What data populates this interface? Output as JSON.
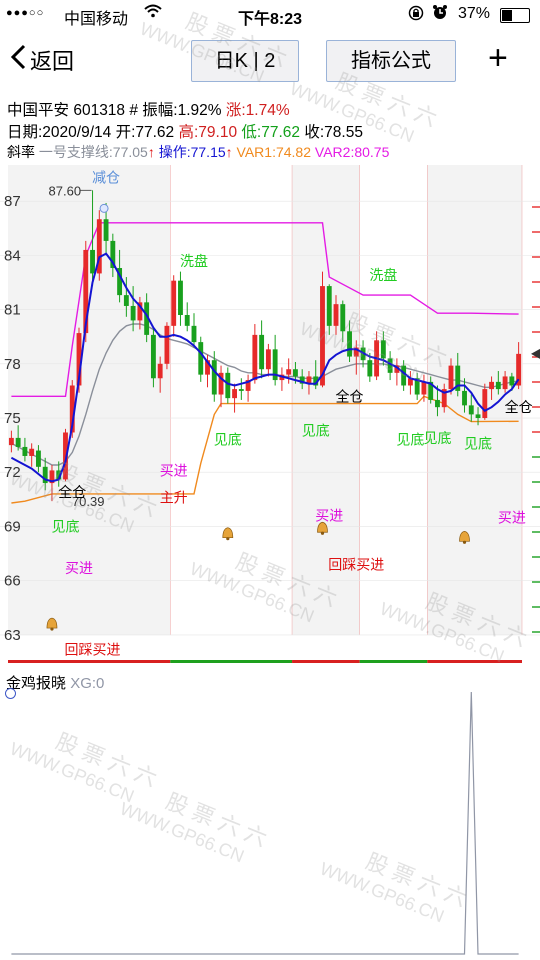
{
  "status_bar": {
    "signal": "●●●○○",
    "carrier": "中国移动",
    "time": "下午8:23",
    "battery_percent": "37%",
    "battery_level": 0.37
  },
  "nav": {
    "back_label": "返回",
    "period_button": "日K | 2",
    "indicator_button": "指标公式",
    "add_label": "+"
  },
  "stock_info": {
    "name": "中国平安",
    "code": "601318",
    "amplitude": "# 振幅:1.92%",
    "change": "涨:1.74%",
    "date": "日期:2020/9/14",
    "open": "开:77.62",
    "high": "高:79.10",
    "low": "低:77.62",
    "close": "收:78.55",
    "legend_prefix": "斜率",
    "legend_support": "一号支撑线:77.05",
    "legend_operate": "操作:77.15",
    "legend_var1": "VAR1:74.82",
    "legend_var2": "VAR2:80.75"
  },
  "colors": {
    "up": "#e62a2a",
    "down": "#19a01e",
    "operate": "#1414d2",
    "support": "#8a8f9a",
    "var1": "#f08a1e",
    "var2": "#e41be4",
    "signal_green": "#22cc22",
    "signal_magenta": "#dd10dd",
    "signal_red": "#dd1010"
  },
  "chart_data": [
    {
      "type": "candlestick",
      "yticks": [
        63,
        66,
        69,
        72,
        75,
        78,
        81,
        84,
        87
      ],
      "ylim": [
        61.5,
        89
      ],
      "max_label": "87.60",
      "min_label": "70.39",
      "candles": [
        {
          "o": 73.5,
          "h": 74.3,
          "l": 73.1,
          "c": 73.9
        },
        {
          "o": 73.9,
          "h": 74.6,
          "l": 73.2,
          "c": 73.4
        },
        {
          "o": 73.4,
          "h": 73.9,
          "l": 72.6,
          "c": 72.9
        },
        {
          "o": 72.9,
          "h": 73.6,
          "l": 72.3,
          "c": 73.3
        },
        {
          "o": 73.2,
          "h": 73.5,
          "l": 72.0,
          "c": 72.3
        },
        {
          "o": 72.3,
          "h": 72.8,
          "l": 71.0,
          "c": 71.4
        },
        {
          "o": 71.4,
          "h": 72.4,
          "l": 70.4,
          "c": 72.1
        },
        {
          "o": 72.1,
          "h": 72.6,
          "l": 71.2,
          "c": 71.6
        },
        {
          "o": 71.6,
          "h": 74.4,
          "l": 71.5,
          "c": 74.2
        },
        {
          "o": 74.2,
          "h": 77.1,
          "l": 73.9,
          "c": 76.8
        },
        {
          "o": 76.8,
          "h": 80.0,
          "l": 76.4,
          "c": 79.7
        },
        {
          "o": 79.7,
          "h": 84.8,
          "l": 79.2,
          "c": 84.3
        },
        {
          "o": 84.3,
          "h": 87.6,
          "l": 82.3,
          "c": 83.0
        },
        {
          "o": 83.0,
          "h": 86.5,
          "l": 82.6,
          "c": 86.0
        },
        {
          "o": 86.0,
          "h": 86.9,
          "l": 84.0,
          "c": 84.8
        },
        {
          "o": 84.8,
          "h": 85.2,
          "l": 82.8,
          "c": 83.3
        },
        {
          "o": 83.3,
          "h": 84.3,
          "l": 81.4,
          "c": 81.8
        },
        {
          "o": 81.8,
          "h": 82.8,
          "l": 80.6,
          "c": 81.2
        },
        {
          "o": 81.2,
          "h": 82.3,
          "l": 79.8,
          "c": 80.4
        },
        {
          "o": 80.4,
          "h": 81.7,
          "l": 79.9,
          "c": 81.4
        },
        {
          "o": 81.4,
          "h": 81.9,
          "l": 79.2,
          "c": 79.6
        },
        {
          "o": 79.6,
          "h": 80.0,
          "l": 76.7,
          "c": 77.2
        },
        {
          "o": 77.2,
          "h": 78.4,
          "l": 76.4,
          "c": 78.0
        },
        {
          "o": 78.0,
          "h": 80.3,
          "l": 77.7,
          "c": 80.1
        },
        {
          "o": 80.1,
          "h": 82.9,
          "l": 79.5,
          "c": 82.6
        },
        {
          "o": 82.6,
          "h": 83.1,
          "l": 80.1,
          "c": 80.7
        },
        {
          "o": 80.7,
          "h": 81.4,
          "l": 79.8,
          "c": 80.1
        },
        {
          "o": 80.1,
          "h": 80.8,
          "l": 78.9,
          "c": 79.2
        },
        {
          "o": 79.2,
          "h": 79.5,
          "l": 77.0,
          "c": 77.4
        },
        {
          "o": 77.4,
          "h": 78.5,
          "l": 76.7,
          "c": 78.2
        },
        {
          "o": 78.2,
          "h": 78.7,
          "l": 75.9,
          "c": 76.3
        },
        {
          "o": 76.3,
          "h": 77.9,
          "l": 75.6,
          "c": 77.5
        },
        {
          "o": 77.5,
          "h": 77.8,
          "l": 75.8,
          "c": 76.1
        },
        {
          "o": 76.1,
          "h": 76.9,
          "l": 75.3,
          "c": 76.6
        },
        {
          "o": 76.6,
          "h": 77.2,
          "l": 76.0,
          "c": 76.5
        },
        {
          "o": 76.5,
          "h": 77.4,
          "l": 75.9,
          "c": 77.1
        },
        {
          "o": 77.1,
          "h": 80.2,
          "l": 76.9,
          "c": 79.6
        },
        {
          "o": 79.6,
          "h": 80.4,
          "l": 77.2,
          "c": 77.7
        },
        {
          "o": 77.7,
          "h": 79.1,
          "l": 77.3,
          "c": 78.8
        },
        {
          "o": 78.8,
          "h": 79.6,
          "l": 76.8,
          "c": 77.1
        },
        {
          "o": 77.1,
          "h": 77.8,
          "l": 76.5,
          "c": 77.4
        },
        {
          "o": 77.4,
          "h": 78.3,
          "l": 76.9,
          "c": 77.7
        },
        {
          "o": 77.7,
          "h": 78.1,
          "l": 76.9,
          "c": 77.3
        },
        {
          "o": 77.3,
          "h": 77.7,
          "l": 76.6,
          "c": 76.9
        },
        {
          "o": 76.9,
          "h": 77.6,
          "l": 76.3,
          "c": 77.3
        },
        {
          "o": 77.3,
          "h": 78.2,
          "l": 76.6,
          "c": 76.8
        },
        {
          "o": 76.8,
          "h": 83.1,
          "l": 76.7,
          "c": 82.3
        },
        {
          "o": 82.3,
          "h": 82.4,
          "l": 79.6,
          "c": 80.1
        },
        {
          "o": 80.1,
          "h": 81.8,
          "l": 79.6,
          "c": 81.3
        },
        {
          "o": 81.3,
          "h": 81.5,
          "l": 79.2,
          "c": 79.8
        },
        {
          "o": 79.8,
          "h": 80.4,
          "l": 78.1,
          "c": 78.4
        },
        {
          "o": 78.4,
          "h": 79.3,
          "l": 77.4,
          "c": 78.9
        },
        {
          "o": 78.9,
          "h": 79.3,
          "l": 77.8,
          "c": 78.2
        },
        {
          "o": 78.2,
          "h": 78.6,
          "l": 77.0,
          "c": 77.3
        },
        {
          "o": 77.3,
          "h": 79.8,
          "l": 77.1,
          "c": 79.3
        },
        {
          "o": 79.3,
          "h": 79.8,
          "l": 77.9,
          "c": 78.3
        },
        {
          "o": 78.3,
          "h": 78.7,
          "l": 77.1,
          "c": 77.5
        },
        {
          "o": 77.5,
          "h": 78.3,
          "l": 76.8,
          "c": 77.9
        },
        {
          "o": 77.9,
          "h": 78.2,
          "l": 76.5,
          "c": 76.8
        },
        {
          "o": 76.8,
          "h": 77.6,
          "l": 76.3,
          "c": 77.2
        },
        {
          "o": 77.2,
          "h": 77.5,
          "l": 76.0,
          "c": 76.3
        },
        {
          "o": 76.3,
          "h": 77.4,
          "l": 75.9,
          "c": 77.0
        },
        {
          "o": 77.0,
          "h": 77.3,
          "l": 75.8,
          "c": 76.0
        },
        {
          "o": 76.0,
          "h": 76.8,
          "l": 75.1,
          "c": 75.6
        },
        {
          "o": 75.6,
          "h": 76.9,
          "l": 75.3,
          "c": 76.6
        },
        {
          "o": 76.6,
          "h": 78.3,
          "l": 76.3,
          "c": 77.9
        },
        {
          "o": 77.9,
          "h": 78.6,
          "l": 76.2,
          "c": 76.5
        },
        {
          "o": 76.5,
          "h": 77.2,
          "l": 75.3,
          "c": 75.7
        },
        {
          "o": 75.7,
          "h": 76.3,
          "l": 74.8,
          "c": 75.2
        },
        {
          "o": 75.2,
          "h": 75.6,
          "l": 74.6,
          "c": 75.0
        },
        {
          "o": 75.0,
          "h": 76.9,
          "l": 74.9,
          "c": 76.6
        },
        {
          "o": 76.6,
          "h": 77.3,
          "l": 76.0,
          "c": 77.0
        },
        {
          "o": 77.0,
          "h": 77.6,
          "l": 76.3,
          "c": 76.6
        },
        {
          "o": 76.6,
          "h": 77.6,
          "l": 76.4,
          "c": 77.3
        },
        {
          "o": 77.3,
          "h": 77.5,
          "l": 76.5,
          "c": 76.8
        },
        {
          "o": 76.8,
          "h": 79.2,
          "l": 76.6,
          "c": 78.55
        }
      ],
      "var2_line": [
        {
          "i": 0,
          "v": 76.2
        },
        {
          "i": 8,
          "v": 76.2
        },
        {
          "i": 9,
          "v": 79
        },
        {
          "i": 11,
          "v": 84
        },
        {
          "i": 13,
          "v": 85.8
        },
        {
          "i": 46,
          "v": 85.8
        },
        {
          "i": 47,
          "v": 82.8
        },
        {
          "i": 52,
          "v": 81.8
        },
        {
          "i": 59,
          "v": 81.8
        },
        {
          "i": 63,
          "v": 80.8
        },
        {
          "i": 68,
          "v": 80.8
        },
        {
          "i": 75,
          "v": 80.75
        }
      ],
      "var1_line": [
        {
          "i": 0,
          "v": 70.3
        },
        {
          "i": 2,
          "v": 70.4
        },
        {
          "i": 6,
          "v": 70.8
        },
        {
          "i": 19,
          "v": 70.8
        },
        {
          "i": 27,
          "v": 70.8
        },
        {
          "i": 28,
          "v": 72.5
        },
        {
          "i": 30,
          "v": 75.2
        },
        {
          "i": 31,
          "v": 75.8
        },
        {
          "i": 46,
          "v": 75.8
        },
        {
          "i": 60,
          "v": 75.8
        },
        {
          "i": 61,
          "v": 76.2
        },
        {
          "i": 64,
          "v": 75.8
        },
        {
          "i": 66,
          "v": 75.2
        },
        {
          "i": 68,
          "v": 74.8
        },
        {
          "i": 75,
          "v": 74.82
        }
      ],
      "operate_line": [
        72.8,
        72.6,
        72.4,
        72.2,
        71.9,
        71.6,
        71.5,
        71.6,
        72.6,
        74.6,
        77.2,
        80.2,
        82.5,
        83.9,
        84.1,
        83.6,
        82.9,
        82.2,
        81.6,
        81.2,
        80.7,
        80.0,
        79.5,
        79.5,
        79.6,
        79.5,
        79.3,
        79.0,
        78.6,
        78.1,
        77.6,
        77.2,
        76.9,
        76.8,
        76.9,
        77.0,
        77.2,
        77.3,
        77.4,
        77.4,
        77.3,
        77.2,
        77.1,
        77.0,
        76.9,
        76.9,
        77.4,
        78.2,
        78.5,
        78.7,
        78.8,
        78.8,
        78.6,
        78.4,
        78.3,
        78.2,
        78.0,
        77.8,
        77.5,
        77.2,
        77.1,
        77.0,
        76.9,
        76.6,
        76.4,
        76.5,
        76.8,
        76.8,
        76.4,
        75.8,
        75.4,
        75.6,
        75.9,
        76.3,
        76.6,
        77.15
      ],
      "support_line": [
        73.6,
        73.4,
        73.2,
        73.0,
        72.8,
        72.6,
        72.4,
        72.4,
        72.6,
        73.1,
        74.0,
        75.2,
        76.5,
        77.7,
        78.6,
        79.3,
        79.8,
        80.1,
        80.2,
        80.2,
        80.1,
        79.9,
        79.6,
        79.4,
        79.3,
        79.2,
        79.1,
        78.9,
        78.7,
        78.5,
        78.3,
        78.1,
        77.9,
        77.8,
        77.6,
        77.5,
        77.5,
        77.4,
        77.4,
        77.4,
        77.3,
        77.3,
        77.3,
        77.2,
        77.2,
        77.2,
        77.3,
        77.5,
        77.7,
        77.8,
        77.9,
        78.0,
        78.0,
        78.0,
        78.0,
        78.0,
        77.9,
        77.9,
        77.8,
        77.7,
        77.6,
        77.5,
        77.4,
        77.3,
        77.2,
        77.1,
        77.1,
        77.0,
        76.9,
        76.8,
        76.7,
        76.7,
        76.8,
        76.9,
        77.0,
        77.05
      ],
      "signals": [
        {
          "text": "减仓",
          "i": 14,
          "v": 88.3,
          "color": "#5b8fd8"
        },
        {
          "text": "洗盘",
          "i": 27,
          "v": 83.7,
          "color": "#22cc22"
        },
        {
          "text": "洗盘",
          "i": 55,
          "v": 82.9,
          "color": "#22cc22"
        },
        {
          "text": "全仓",
          "i": 9,
          "v": 70.9,
          "color": "#000000"
        },
        {
          "text": "全仓",
          "i": 50,
          "v": 76.2,
          "color": "#000000"
        },
        {
          "text": "全仓",
          "i": 75,
          "v": 75.6,
          "color": "#000000"
        },
        {
          "text": "见底",
          "i": 32,
          "v": 73.8,
          "color": "#22cc22"
        },
        {
          "text": "见底",
          "i": 45,
          "v": 74.3,
          "color": "#22cc22"
        },
        {
          "text": "见底",
          "i": 59,
          "v": 73.8,
          "color": "#22cc22"
        },
        {
          "text": "见底",
          "i": 63,
          "v": 73.9,
          "color": "#22cc22"
        },
        {
          "text": "见底",
          "i": 69,
          "v": 73.6,
          "color": "#22cc22"
        },
        {
          "text": "见底",
          "i": 8,
          "v": 69.0,
          "color": "#22cc22"
        },
        {
          "text": "买进",
          "i": 24,
          "v": 72.1,
          "color": "#dd10dd"
        },
        {
          "text": "买进",
          "i": 47,
          "v": 69.6,
          "color": "#dd10dd"
        },
        {
          "text": "买进",
          "i": 10,
          "v": 66.7,
          "color": "#dd10dd"
        },
        {
          "text": "买进",
          "i": 74,
          "v": 69.5,
          "color": "#dd10dd"
        },
        {
          "text": "主升",
          "i": 24,
          "v": 70.6,
          "color": "#dd1010"
        },
        {
          "text": "回踩买进",
          "i": 51,
          "v": 66.9,
          "color": "#dd1010"
        },
        {
          "text": "回踩买进",
          "i": 12,
          "v": 62.2,
          "color": "#dd1010"
        }
      ],
      "bells": [
        {
          "i": 6,
          "v": 63.6
        },
        {
          "i": 32,
          "v": 68.6
        },
        {
          "i": 46,
          "v": 68.9
        },
        {
          "i": 67,
          "v": 68.4
        }
      ]
    },
    {
      "type": "line",
      "title": "金鸡报晓",
      "legend": "XG:0",
      "ylim": [
        0,
        1
      ],
      "values_nonzero": [
        {
          "i": 68,
          "v": 1
        }
      ],
      "count": 76
    }
  ],
  "watermark": {
    "text_cn": "股 票 六 六",
    "text_en": "WWW.GP66.CN"
  }
}
